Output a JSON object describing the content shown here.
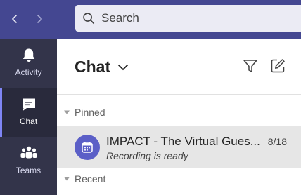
{
  "colors": {
    "topbar": "#444791",
    "rail": "#33344a",
    "accent": "#7f85f5",
    "avatar": "#5b5fc7",
    "selected_row": "#e6e6e6"
  },
  "topbar": {
    "back_icon": "chevron-left-icon",
    "forward_icon": "chevron-right-icon",
    "search": {
      "placeholder": "Search",
      "icon": "search-icon"
    }
  },
  "rail": {
    "items": [
      {
        "label": "Activity",
        "icon": "bell-icon"
      },
      {
        "label": "Chat",
        "icon": "chat-icon",
        "active": true
      },
      {
        "label": "Teams",
        "icon": "teams-icon"
      }
    ]
  },
  "panel": {
    "title": "Chat",
    "title_icon": "chevron-down-icon",
    "filter_icon": "filter-icon",
    "new_chat_icon": "compose-icon",
    "sections": {
      "pinned": {
        "label": "Pinned"
      },
      "recent": {
        "label": "Recent"
      }
    },
    "pinned_chats": [
      {
        "title": "IMPACT - The Virtual Gues...",
        "preview": "Recording is ready",
        "date": "8/18",
        "avatar_icon": "calendar-icon"
      }
    ]
  }
}
